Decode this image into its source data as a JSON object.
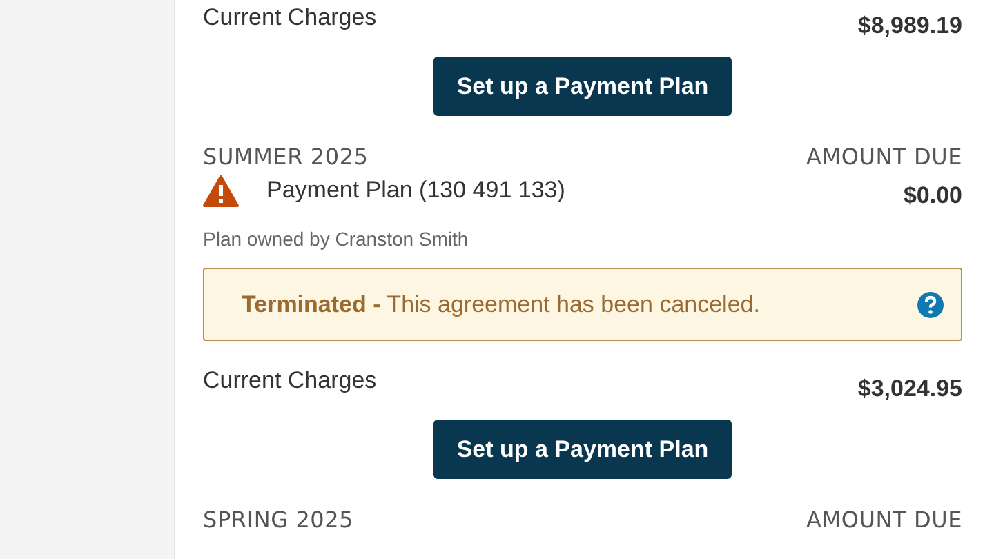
{
  "sections": [
    {
      "charges_label": "Current Charges",
      "charges_amount": "$8,989.19",
      "button": "Set up a Payment Plan"
    },
    {
      "term": "SUMMER 2025",
      "amount_due_label": "AMOUNT DUE",
      "plan": {
        "name": "Payment Plan (130 491 133)",
        "amount": "$0.00",
        "warning": true,
        "owner": "Plan owned by Cranston Smith"
      },
      "alert": {
        "text": "**Terminated -** This agreement has been canceled."
      },
      "charges_label": "Current Charges",
      "charges_amount": "$3,024.95",
      "button": "Set up a Payment Plan"
    },
    {
      "term": "SPRING 2025",
      "amount_due_label": "AMOUNT DUE"
    }
  ]
}
